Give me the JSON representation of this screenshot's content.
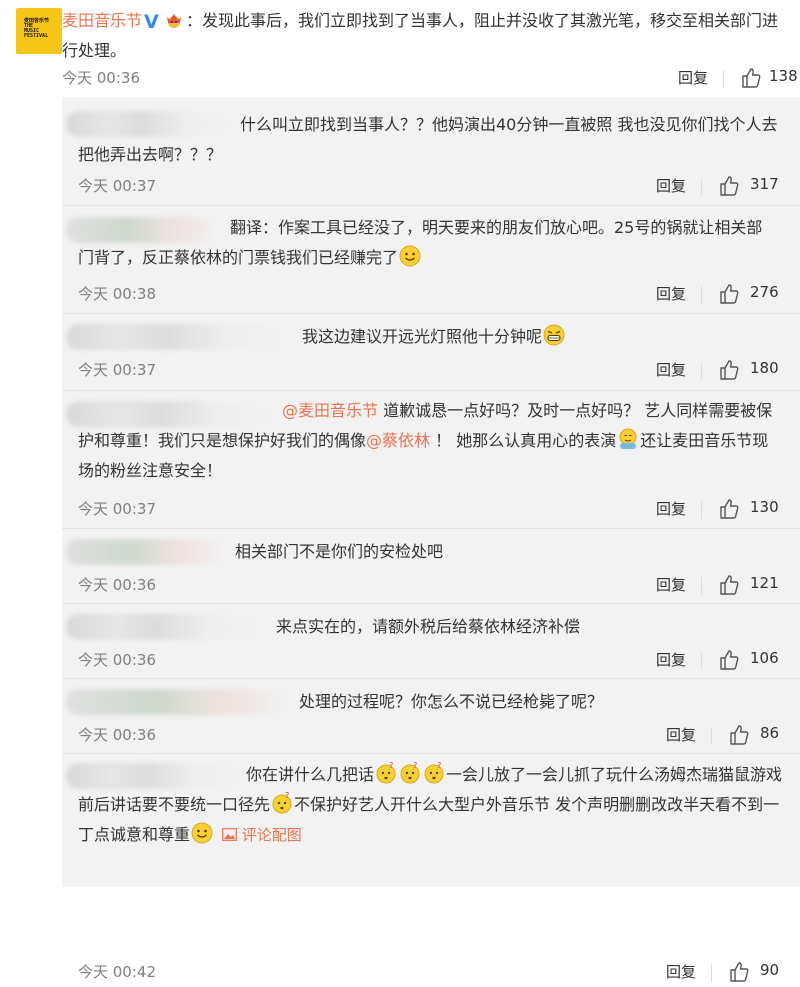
{
  "post": {
    "author": "麦田音乐节",
    "logo_text": "麦田音乐节\nTHE\nMUSIC\nFESTIVAL",
    "text": "：发现此事后，我们立即找到了当事人，阻止并没收了其激光笔，移交至相关部门进行处理。",
    "time": "今天 00:36",
    "reply_label": "回复",
    "likes": "138"
  },
  "colors": {
    "link": "#eb7350",
    "verified": "#2d8ee8",
    "reply_bg": "#f2f2f2"
  },
  "replies": [
    {
      "text": "什么叫立即找到当事人？？他妈演出40分钟一直被照 我也没见你们找个人去把他弄出去啊？？？",
      "time": "今天 00:37",
      "reply_label": "回复",
      "likes": "317"
    },
    {
      "text_a": "翻译：作案工具已经没了，明天要来的朋友们放心吧。25号的锅就让相关部门背了，反正蔡依林的门票钱我们已经赚完了",
      "time": "今天 00:38",
      "reply_label": "回复",
      "likes": "276"
    },
    {
      "text": "我这边建议开远光灯照他十分钟呢",
      "time": "今天 00:37",
      "reply_label": "回复",
      "likes": "180"
    },
    {
      "mention1": "@麦田音乐节",
      "text_a": " 道歉诚恳一点好吗？及时一点好吗？ 艺人同样需要被保护和尊重！我们只是想保护好我们的偶像",
      "mention2": "@蔡依林",
      "text_b": " ！ 她那么认真用心的表演",
      "text_c": "还让麦田音乐节现场的粉丝注意安全！",
      "time": "今天 00:37",
      "reply_label": "回复",
      "likes": "130"
    },
    {
      "text": "相关部门不是你们的安检处吧",
      "time": "今天 00:36",
      "reply_label": "回复",
      "likes": "121"
    },
    {
      "text": "来点实在的，请额外税后给蔡依林经济补偿",
      "time": "今天 00:36",
      "reply_label": "回复",
      "likes": "106"
    },
    {
      "text": "处理的过程呢？你怎么不说已经枪毙了呢？",
      "time": "今天 00:36",
      "reply_label": "回复",
      "likes": "86"
    },
    {
      "text_a": "你在讲什么几把话",
      "text_b": "一会儿放了一会儿抓了玩什么汤姆杰瑞猫鼠游戏  前后讲话要不要统一口径先",
      "text_c": "不保护好艺人开什么大型户外音乐节  发个声明删删改改半天看不到一丁点诚意和尊重",
      "pic_label": "评论配图",
      "time": "今天 00:42",
      "reply_label": "回复",
      "likes": "90"
    }
  ]
}
